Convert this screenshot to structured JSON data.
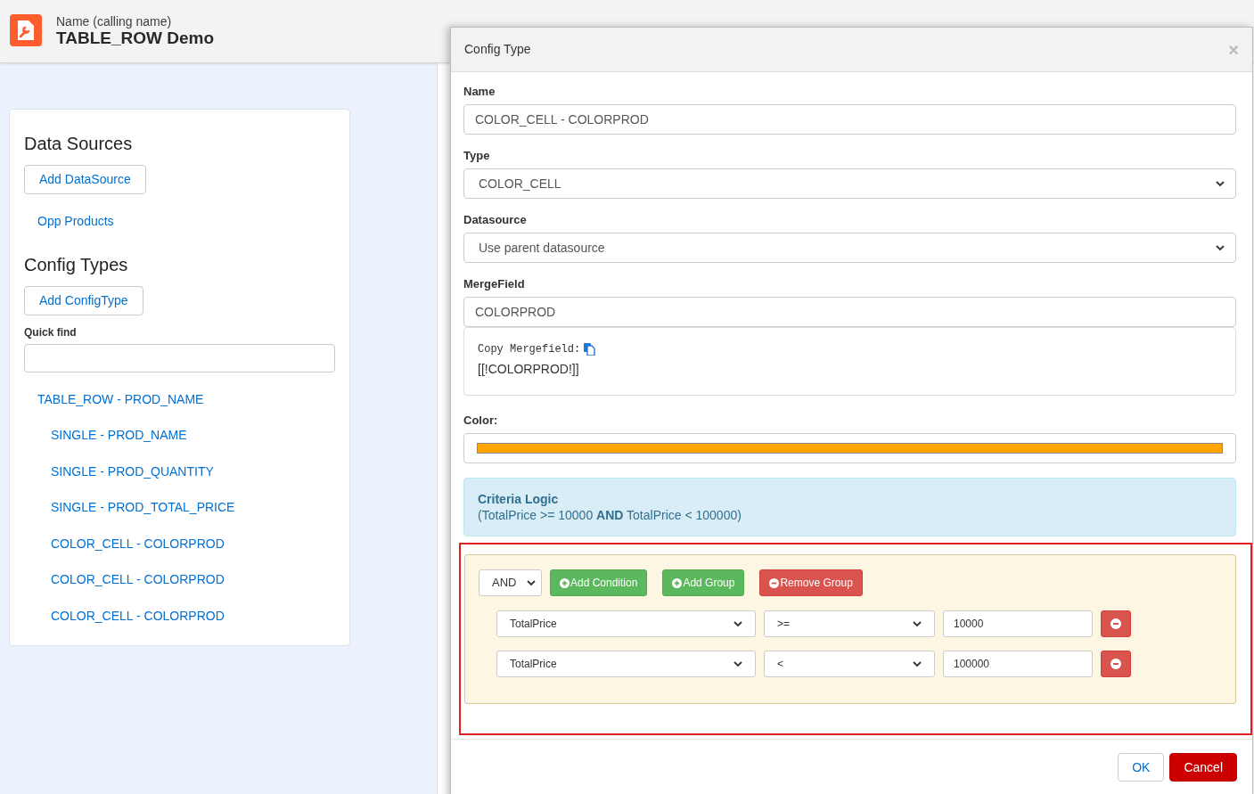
{
  "app": {
    "subtitle": "Name (calling name)",
    "title": "TABLE_ROW Demo"
  },
  "sidebar": {
    "data_sources_title": "Data Sources",
    "add_datasource": "Add DataSource",
    "data_sources": [
      "Opp Products"
    ],
    "config_types_title": "Config Types",
    "add_configtype": "Add ConfigType",
    "quick_find": {
      "label": "Quick find"
    },
    "config_types": [
      {
        "label": "TABLE_ROW - PROD_NAME",
        "children": [
          {
            "label": "SINGLE - PROD_NAME"
          },
          {
            "label": "SINGLE - PROD_QUANTITY"
          },
          {
            "label": "SINGLE - PROD_TOTAL_PRICE"
          },
          {
            "label": "COLOR_CELL - COLORPROD"
          },
          {
            "label": "COLOR_CELL - COLORPROD"
          },
          {
            "label": "COLOR_CELL - COLORPROD"
          }
        ]
      }
    ]
  },
  "modal": {
    "title": "Config Type",
    "close": "×",
    "fields": [
      {
        "kind": "input",
        "label": "Name",
        "value": "COLOR_CELL - COLORPROD"
      },
      {
        "kind": "select",
        "label": "Type",
        "value": "COLOR_CELL"
      },
      {
        "kind": "select",
        "label": "Datasource",
        "value": "Use parent datasource"
      },
      {
        "kind": "input",
        "label": "MergeField",
        "value": "COLORPROD"
      }
    ],
    "mergefield_box": {
      "copy_label": "Copy Mergefield:",
      "mergefield": "[[!COLORPROD!]]"
    },
    "color_field": {
      "label": "Color:",
      "color": "#ffa500"
    },
    "criteria": {
      "title": "Criteria Logic",
      "logic": "(TotalPrice >= 10000 **AND** TotalPrice < 100000)"
    },
    "group": {
      "operator": "AND",
      "buttons": [
        {
          "label": "Add Condition",
          "kind": "add"
        },
        {
          "label": "Add Group",
          "kind": "add"
        },
        {
          "label": "Remove Group",
          "kind": "remove"
        }
      ],
      "conditions": [
        {
          "field": "TotalPrice",
          "operator": ">=",
          "value": "10000"
        },
        {
          "field": "TotalPrice",
          "operator": "<",
          "value": "100000"
        }
      ]
    },
    "buttons": [
      {
        "label": "OK",
        "kind": "default"
      },
      {
        "label": "Cancel",
        "kind": "danger"
      }
    ]
  }
}
